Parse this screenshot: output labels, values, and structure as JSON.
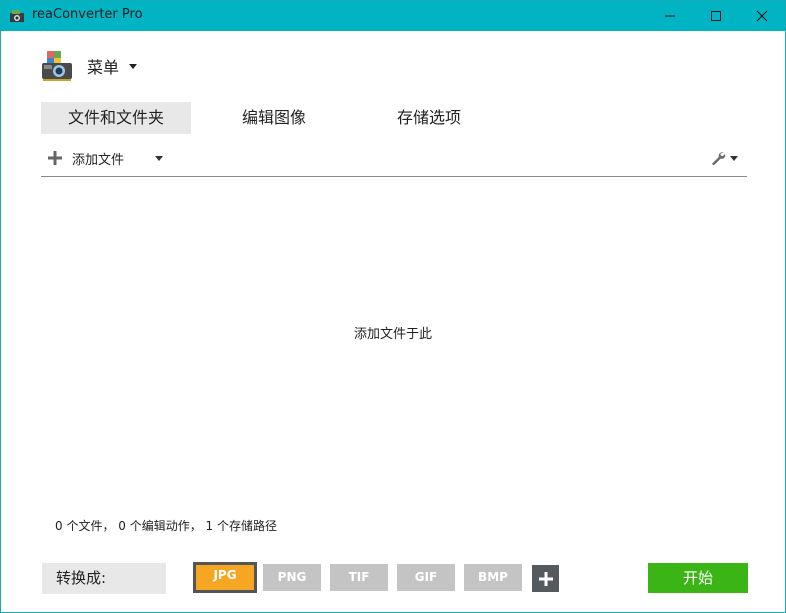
{
  "window": {
    "title": "reaConverter Pro"
  },
  "menu": {
    "label": "菜单"
  },
  "tabs": [
    {
      "label": "文件和文件夹",
      "active": true
    },
    {
      "label": "编辑图像",
      "active": false
    },
    {
      "label": "存储选项",
      "active": false
    }
  ],
  "toolbar": {
    "add_files_label": "添加文件"
  },
  "drop_area": {
    "hint": "添加文件于此"
  },
  "status": {
    "text": "0 个文件， 0 个编辑动作， 1 个存储路径"
  },
  "convert": {
    "label": "转换成:",
    "formats": [
      "JPG",
      "PNG",
      "TIF",
      "GIF",
      "BMP"
    ],
    "selected": "JPG"
  },
  "start_button": {
    "label": "开始"
  },
  "colors": {
    "titlebar": "#00b4c4",
    "selected_format": "#f5a623",
    "start": "#3bb515",
    "format_inactive": "#c4c4c4"
  }
}
